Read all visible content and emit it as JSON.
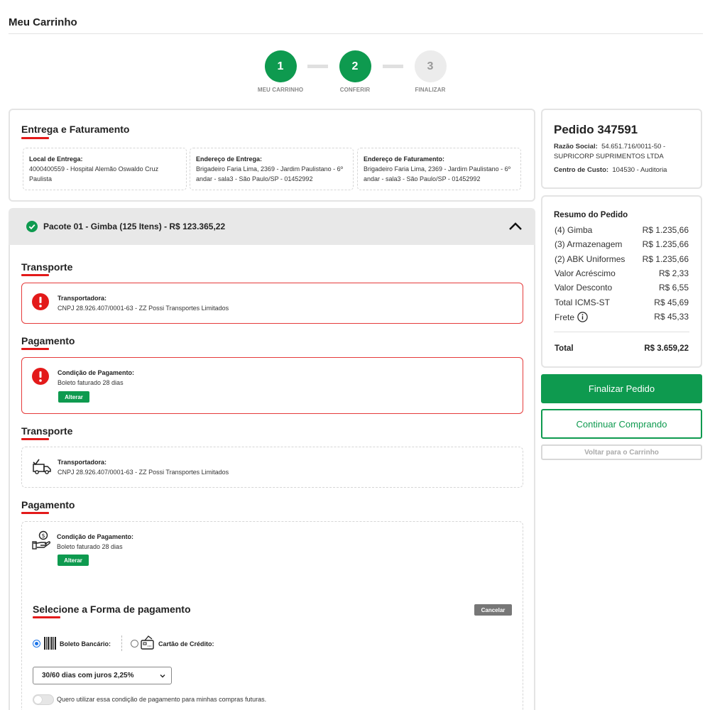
{
  "page": {
    "title": "Meu Carrinho"
  },
  "stepper": [
    {
      "number": "1",
      "label": "MEU CARRINHO"
    },
    {
      "number": "2",
      "label": "CONFERIR"
    },
    {
      "number": "3",
      "label": "FINALIZAR"
    }
  ],
  "entrega": {
    "title": "Entrega e Faturamento",
    "local_label": "Local de Entrega:",
    "local_value": "4000400559 - Hospital Alemão Oswaldo Cruz Paulista",
    "endereco_entrega_label": "Endereço de Entrega:",
    "endereco_entrega_value": "Brigadeiro Faria Lima, 2369 - Jardim Paulistano - 6º andar - sala3 - São Paulo/SP - 01452992",
    "endereco_fat_label": "Endereço de Faturamento:",
    "endereco_fat_value": "Brigadeiro Faria Lima, 2369 - Jardim Paulistano - 6º andar - sala3 - São Paulo/SP - 01452992"
  },
  "pacote": {
    "title": "Pacote 01 - Gimba (125 Itens) - R$ 123.365,22",
    "transporte_title": "Transporte",
    "pagamento_title": "Pagamento",
    "transportadora_label": "Transportadora:",
    "transportadora_value": "CNPJ 28.926.407/0001-63 - ZZ Possi Transportes Limitados",
    "condicao_label": "Condição de Pagamento:",
    "condicao_value": "Boleto faturado 28 dias",
    "alterar_label": "Alterar"
  },
  "forma_pagamento": {
    "title": "Selecione a Forma de pagamento",
    "cancelar_label": "Cancelar",
    "boleto_label": "Boleto Bancário:",
    "cartao_label": "Cartão de Crédito:",
    "selected_option": "30/60 dias com juros 2,25%",
    "toggle_label": "Quero utilizar essa condição de pagamento para minhas compras futuras."
  },
  "pedido": {
    "title": "Pedido 347591",
    "razao_label": "Razão Social:",
    "razao_value": "54.651.716/0011-50 - SUPRICORP SUPRIMENTOS LTDA",
    "centro_label": "Centro de Custo:",
    "centro_value": "104530 - Auditoria"
  },
  "resumo": {
    "title": "Resumo do Pedido",
    "rows": [
      {
        "label": "(4) Gimba",
        "value": "R$ 1.235,66"
      },
      {
        "label": "(3) Armazenagem",
        "value": "R$ 1.235,66"
      },
      {
        "label": "(2) ABK Uniformes",
        "value": "R$ 1.235,66"
      },
      {
        "label": "Valor Acréscimo",
        "value": "R$ 2,33"
      },
      {
        "label": "Valor Desconto",
        "value": "R$ 6,55"
      },
      {
        "label": "Total ICMS-ST",
        "value": "R$ 45,69"
      },
      {
        "label": "Frete",
        "value": "R$ 45,33"
      }
    ],
    "total_label": "Total",
    "total_value": "R$ 3.659,22"
  },
  "actions": {
    "finalizar": "Finalizar Pedido",
    "continuar": "Continuar Comprando",
    "voltar": "Voltar para o Carrinho"
  },
  "colors": {
    "brand_green": "#0e9a4f",
    "accent_red": "#e31a1a",
    "alert_red": "#e53b3b"
  }
}
